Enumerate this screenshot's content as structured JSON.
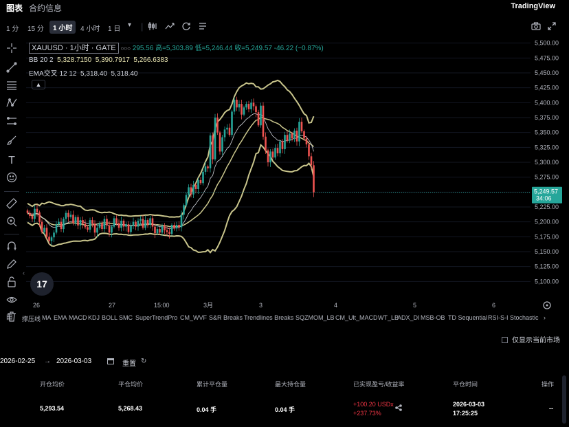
{
  "tabs": [
    {
      "label": "图表",
      "active": true
    },
    {
      "label": "合约信息",
      "active": false
    }
  ],
  "brand": "TradingView",
  "timeframes": [
    {
      "label": "1 分",
      "active": false
    },
    {
      "label": "15 分",
      "active": false
    },
    {
      "label": "1 小时",
      "active": true
    },
    {
      "label": "4 小时",
      "active": false
    },
    {
      "label": "1 日",
      "active": false
    }
  ],
  "toolbar_icons": [
    "candles-icon",
    "compare-icon",
    "indicators-icon",
    "replay-icon",
    "alert-icon"
  ],
  "legend": {
    "symbol": "XAUUSD · 1小时 · GATE",
    "more": "○○○",
    "open_tail": "295.56",
    "high": "高=5,303.89",
    "low": "低=5,246.44",
    "close": "收=5,249.57",
    "change": "-46.22 (−0.87%)",
    "bb_label": "BB 20 2",
    "bb_values": [
      "5,328.7150",
      "5,390.7917",
      "5,266.6383"
    ],
    "ema_label": "EMA交叉 12 12",
    "ema_values": [
      "5,318.40",
      "5,318.40"
    ]
  },
  "price_axis": [
    "5,500.00",
    "5,475.00",
    "5,450.00",
    "5,425.00",
    "5,400.00",
    "5,375.00",
    "5,350.00",
    "5,325.00",
    "5,300.00",
    "5,275.00",
    "5,250.00",
    "5,225.00",
    "5,200.00",
    "5,175.00",
    "5,150.00",
    "5,125.00",
    "5,100.00"
  ],
  "current_price": "5,249.57",
  "countdown": "34:06",
  "time_axis": [
    "26",
    "27",
    "15:00",
    "3月",
    "3",
    "4",
    "5",
    "6"
  ],
  "indicators": [
    "撑压线",
    "MA",
    "EMA",
    "MACD",
    "KDJ",
    "BOLL",
    "SMC",
    "SuperTrendPro",
    "CM_WVF",
    "S&R Breaks",
    "Trendlines Breaks",
    "SQZMOM_LB",
    "CM_Ult_MACD",
    "WT_LB",
    "ADX_DI",
    "MSB-OB",
    "TD Sequential",
    "RSI-S-I",
    "Stochastic"
  ],
  "filter_label": "仅显示当前市场",
  "date_range": {
    "start": "2026-02-25",
    "arrow": "→",
    "end": "2026-03-03",
    "reset": "重置"
  },
  "table": {
    "headers": [
      "开仓均价",
      "平仓均价",
      "累计平仓量",
      "最大持仓量",
      "已实现盈亏/收益率",
      "平仓时间",
      "操作"
    ],
    "row": {
      "open_avg": "5,293.54",
      "close_avg": "5,268.43",
      "closed_qty": "0.04 手",
      "max_pos": "0.04 手",
      "pnl": "+100.20 USDx",
      "pnl_pct": "+237.73%",
      "close_date": "2026-03-03",
      "close_time": "17:25:25",
      "action": "--"
    }
  },
  "colors": {
    "up": "#26a69a",
    "down": "#ef5350",
    "bb": "#c9c58c",
    "ema": "#d1d4dc",
    "price_line": "#26a69a"
  },
  "chart_data": {
    "type": "candlestick",
    "symbol": "XAUUSD",
    "interval": "1小时",
    "ylim": [
      5090,
      5510
    ],
    "close": [
      5215,
      5210,
      5205,
      5222,
      5216,
      5200,
      5183,
      5190,
      5175,
      5168,
      5174,
      5182,
      5196,
      5200,
      5188,
      5205,
      5215,
      5208,
      5212,
      5198,
      5208,
      5194,
      5203,
      5197,
      5191,
      5187,
      5203,
      5197,
      5182,
      5190,
      5198,
      5188,
      5205,
      5194,
      5182,
      5192,
      5206,
      5198,
      5190,
      5202,
      5192,
      5196,
      5183,
      5193,
      5200,
      5192,
      5202,
      5205,
      5190,
      5203,
      5195,
      5206,
      5192,
      5181,
      5188,
      5182,
      5193,
      5186,
      5183,
      5180,
      5195,
      5189,
      5195,
      5191,
      5212,
      5228,
      5245,
      5258,
      5246,
      5262,
      5255,
      5270,
      5265,
      5284,
      5293,
      5290,
      5345,
      5305,
      5375,
      5350,
      5318,
      5342,
      5355,
      5358,
      5346,
      5385,
      5405,
      5392,
      5398,
      5380,
      5392,
      5398,
      5389,
      5400,
      5394,
      5384,
      5362,
      5395,
      5343,
      5320,
      5300,
      5318,
      5308,
      5324,
      5315,
      5335,
      5322,
      5346,
      5336,
      5348,
      5340,
      5353,
      5335,
      5368,
      5352,
      5340,
      5330,
      5310,
      5295,
      5249.57
    ]
  }
}
